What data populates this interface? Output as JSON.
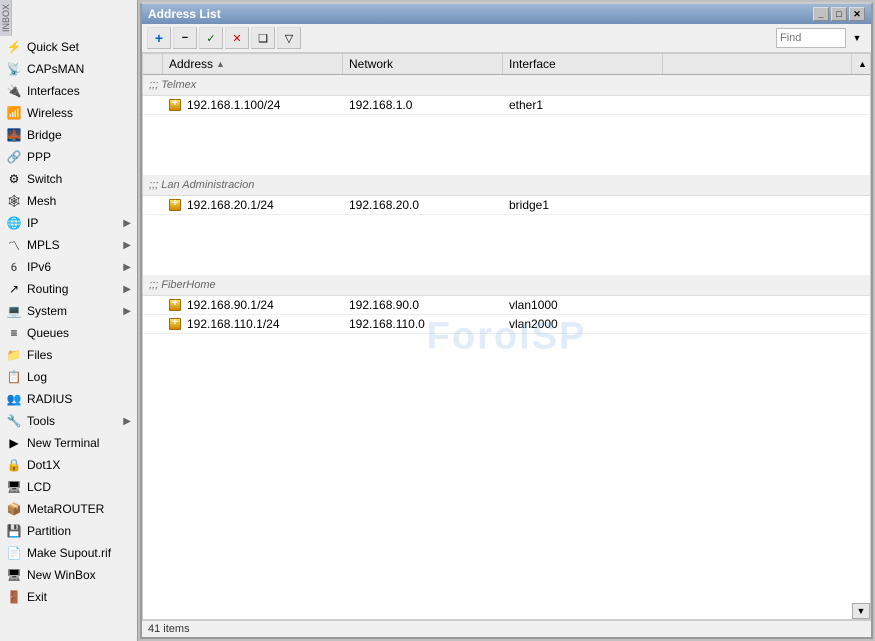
{
  "window": {
    "title": "Address List",
    "controls": {
      "minimize": "_",
      "maximize": "□",
      "close": "✕"
    }
  },
  "toolbar": {
    "add_label": "+",
    "remove_label": "−",
    "check_label": "✓",
    "cross_label": "✕",
    "copy_label": "❑",
    "filter_label": "▼",
    "find_placeholder": "Find"
  },
  "table": {
    "columns": [
      {
        "id": "check",
        "label": ""
      },
      {
        "id": "address",
        "label": "Address"
      },
      {
        "id": "network",
        "label": "Network"
      },
      {
        "id": "interface",
        "label": "Interface"
      },
      {
        "id": "extra",
        "label": ""
      }
    ],
    "groups": [
      {
        "name": ";;; Telmex",
        "rows": [
          {
            "address": "192.168.1.100/24",
            "network": "192.168.1.0",
            "interface": "ether1"
          }
        ]
      },
      {
        "name": ";;; Lan Administracion",
        "rows": [
          {
            "address": "192.168.20.1/24",
            "network": "192.168.20.0",
            "interface": "bridge1"
          }
        ]
      },
      {
        "name": ";;; FiberHome",
        "rows": [
          {
            "address": "192.168.90.1/24",
            "network": "192.168.90.0",
            "interface": "vlan1000"
          },
          {
            "address": "192.168.110.1/24",
            "network": "192.168.110.0",
            "interface": "vlan2000"
          }
        ]
      }
    ]
  },
  "watermark": "ForoISP",
  "status": {
    "items_label": "41 items"
  },
  "sidebar": {
    "items": [
      {
        "id": "quick-set",
        "label": "Quick Set",
        "icon": "⚡",
        "hasArrow": false
      },
      {
        "id": "capsman",
        "label": "CAPsMAN",
        "icon": "📡",
        "hasArrow": false
      },
      {
        "id": "interfaces",
        "label": "Interfaces",
        "icon": "🔌",
        "hasArrow": false
      },
      {
        "id": "wireless",
        "label": "Wireless",
        "icon": "📶",
        "hasArrow": false
      },
      {
        "id": "bridge",
        "label": "Bridge",
        "icon": "🌉",
        "hasArrow": false
      },
      {
        "id": "ppp",
        "label": "PPP",
        "icon": "🔗",
        "hasArrow": false
      },
      {
        "id": "switch",
        "label": "Switch",
        "icon": "⚙",
        "hasArrow": false
      },
      {
        "id": "mesh",
        "label": "Mesh",
        "icon": "🕸",
        "hasArrow": false
      },
      {
        "id": "ip",
        "label": "IP",
        "icon": "🌐",
        "hasArrow": true
      },
      {
        "id": "mpls",
        "label": "MPLS",
        "icon": "〽",
        "hasArrow": true
      },
      {
        "id": "ipv6",
        "label": "IPv6",
        "icon": "6️",
        "hasArrow": true
      },
      {
        "id": "routing",
        "label": "Routing",
        "icon": "↗",
        "hasArrow": true
      },
      {
        "id": "system",
        "label": "System",
        "icon": "💻",
        "hasArrow": true
      },
      {
        "id": "queues",
        "label": "Queues",
        "icon": "≡",
        "hasArrow": false
      },
      {
        "id": "files",
        "label": "Files",
        "icon": "📁",
        "hasArrow": false
      },
      {
        "id": "log",
        "label": "Log",
        "icon": "📋",
        "hasArrow": false
      },
      {
        "id": "radius",
        "label": "RADIUS",
        "icon": "👥",
        "hasArrow": false
      },
      {
        "id": "tools",
        "label": "Tools",
        "icon": "🔧",
        "hasArrow": true
      },
      {
        "id": "new-terminal",
        "label": "New Terminal",
        "icon": "▶",
        "hasArrow": false
      },
      {
        "id": "dot1x",
        "label": "Dot1X",
        "icon": "🔒",
        "hasArrow": false
      },
      {
        "id": "lcd",
        "label": "LCD",
        "icon": "🖥",
        "hasArrow": false
      },
      {
        "id": "metarouter",
        "label": "MetaROUTER",
        "icon": "📦",
        "hasArrow": false
      },
      {
        "id": "partition",
        "label": "Partition",
        "icon": "💾",
        "hasArrow": false
      },
      {
        "id": "make-supout",
        "label": "Make Supout.rif",
        "icon": "📄",
        "hasArrow": false
      },
      {
        "id": "new-winbox",
        "label": "New WinBox",
        "icon": "🖥",
        "hasArrow": false
      },
      {
        "id": "exit",
        "label": "Exit",
        "icon": "🚪",
        "hasArrow": false
      }
    ]
  }
}
